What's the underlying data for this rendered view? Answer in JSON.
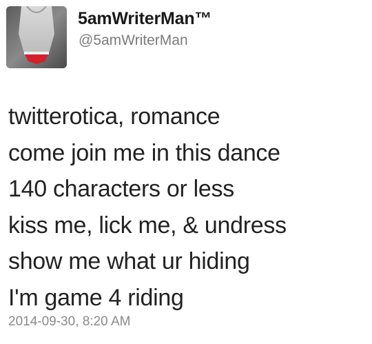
{
  "tweet": {
    "display_name": "5amWriterMan™",
    "handle": "@5amWriterMan",
    "lines": [
      "twitterotica, romance",
      "come join me in this dance",
      "140 characters or less",
      "kiss me, lick me, & undress",
      "show me what ur hiding",
      "I'm game 4 riding"
    ],
    "timestamp": "2014-09-30, 8:20 AM"
  },
  "colors": {
    "name": "#1a1a1a",
    "handle": "#7b7b7b",
    "body": "#222222",
    "timestamp": "#8a8a8a",
    "avatar_accent": "#d3202a"
  },
  "icons": {
    "avatar": "profile-photo"
  }
}
